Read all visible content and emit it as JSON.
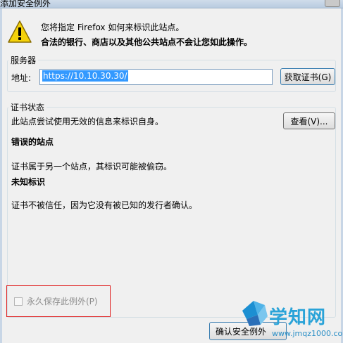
{
  "window": {
    "title": "添加安全例外"
  },
  "intro": {
    "line1": "您将指定 Firefox 如何来标识此站点。",
    "line2": "合法的银行、商店以及其他公共站点不会让您如此操作。"
  },
  "server": {
    "legend": "服务器",
    "address_label": "地址:",
    "address_value": "https://10.10.30.30/",
    "get_cert_label": "获取证书(G)"
  },
  "cert_status": {
    "legend": "证书状态",
    "description": "此站点尝试使用无效的信息来标识自身。",
    "view_label": "查看(V)...",
    "wrong_site_heading": "错误的站点",
    "wrong_site_text": "证书属于另一个站点，其标识可能被偷窃。",
    "unknown_heading": "未知标识",
    "unknown_text": "证书不被信任，因为它没有被已知的发行者确认。"
  },
  "options": {
    "permanent_label": "永久保存此例外(P)",
    "permanent_checked": false
  },
  "footer": {
    "confirm_label": "确认安全例外"
  },
  "watermark": {
    "brand": "学知网",
    "url": "www.jmqz1000.com"
  },
  "colors": {
    "selection": "#3399ff",
    "highlight_box": "#e02020",
    "watermark_blue": "#2aa3d8"
  }
}
